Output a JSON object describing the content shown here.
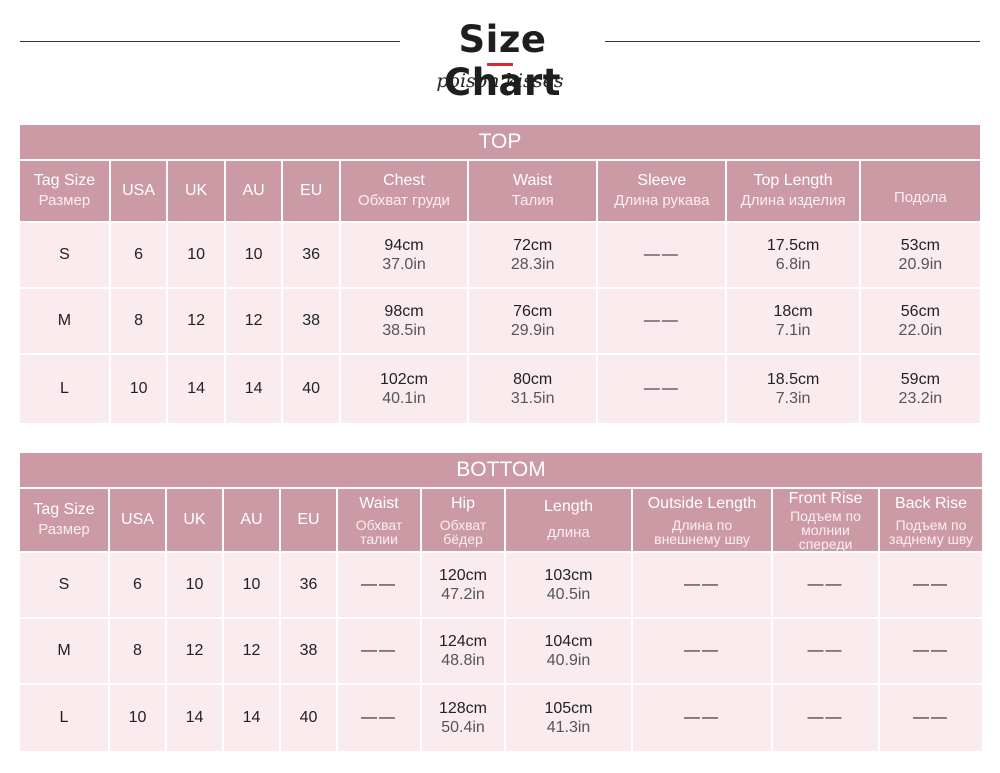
{
  "header": {
    "title": "Size Chart",
    "subtitle": "poison kisses"
  },
  "top": {
    "section": "TOP",
    "headers": [
      {
        "en": "Tag Size",
        "ru": "Размер"
      },
      {
        "en": "USA",
        "ru": ""
      },
      {
        "en": "UK",
        "ru": ""
      },
      {
        "en": "AU",
        "ru": ""
      },
      {
        "en": "EU",
        "ru": ""
      },
      {
        "en": "Chest",
        "ru": "Обхват груди"
      },
      {
        "en": "Waist",
        "ru": "Талия"
      },
      {
        "en": "Sleeve",
        "ru": "Длина рукава"
      },
      {
        "en": "Top Length",
        "ru": "Длина изделия"
      },
      {
        "en": "",
        "ru": "Подола"
      }
    ],
    "rows": [
      {
        "tag": "S",
        "usa": "6",
        "uk": "10",
        "au": "10",
        "eu": "36",
        "chest_cm": "94cm",
        "chest_in": "37.0in",
        "waist_cm": "72cm",
        "waist_in": "28.3in",
        "sleeve": "——",
        "length_cm": "17.5cm",
        "length_in": "6.8in",
        "hem_cm": "53cm",
        "hem_in": "20.9in"
      },
      {
        "tag": "M",
        "usa": "8",
        "uk": "12",
        "au": "12",
        "eu": "38",
        "chest_cm": "98cm",
        "chest_in": "38.5in",
        "waist_cm": "76cm",
        "waist_in": "29.9in",
        "sleeve": "——",
        "length_cm": "18cm",
        "length_in": "7.1in",
        "hem_cm": "56cm",
        "hem_in": "22.0in"
      },
      {
        "tag": "L",
        "usa": "10",
        "uk": "14",
        "au": "14",
        "eu": "40",
        "chest_cm": "102cm",
        "chest_in": "40.1in",
        "waist_cm": "80cm",
        "waist_in": "31.5in",
        "sleeve": "——",
        "length_cm": "18.5cm",
        "length_in": "7.3in",
        "hem_cm": "59cm",
        "hem_in": "23.2in"
      }
    ]
  },
  "bottom": {
    "section": "BOTTOM",
    "headers": [
      {
        "en": "Tag Size",
        "ru": "Размер"
      },
      {
        "en": "USA",
        "ru": ""
      },
      {
        "en": "UK",
        "ru": ""
      },
      {
        "en": "AU",
        "ru": ""
      },
      {
        "en": "EU",
        "ru": ""
      },
      {
        "en": "Waist",
        "ru1": "Обхват",
        "ru2": "талии"
      },
      {
        "en": "Hip",
        "ru1": "Обхват",
        "ru2": "бёдер"
      },
      {
        "en": "Length",
        "ru1": "длина",
        "ru2": ""
      },
      {
        "en": "Outside Length",
        "ru1": "Длина по",
        "ru2": "внешнему шву"
      },
      {
        "en": "Front Rise",
        "ru1": "Подъем по",
        "ru2": "молнии",
        "ru3": "спереди"
      },
      {
        "en": "Back Rise",
        "ru1": "Подъем по",
        "ru2": "заднему шву"
      }
    ],
    "rows": [
      {
        "tag": "S",
        "usa": "6",
        "uk": "10",
        "au": "10",
        "eu": "36",
        "waist": "——",
        "hip_cm": "120cm",
        "hip_in": "47.2in",
        "length_cm": "103cm",
        "length_in": "40.5in",
        "outside": "——",
        "front": "——",
        "back": "——"
      },
      {
        "tag": "M",
        "usa": "8",
        "uk": "12",
        "au": "12",
        "eu": "38",
        "waist": "——",
        "hip_cm": "124cm",
        "hip_in": "48.8in",
        "length_cm": "104cm",
        "length_in": "40.9in",
        "outside": "——",
        "front": "——",
        "back": "——"
      },
      {
        "tag": "L",
        "usa": "10",
        "uk": "14",
        "au": "14",
        "eu": "40",
        "waist": "——",
        "hip_cm": "128cm",
        "hip_in": "50.4in",
        "length_cm": "105cm",
        "length_in": "41.3in",
        "outside": "——",
        "front": "——",
        "back": "——"
      }
    ]
  }
}
